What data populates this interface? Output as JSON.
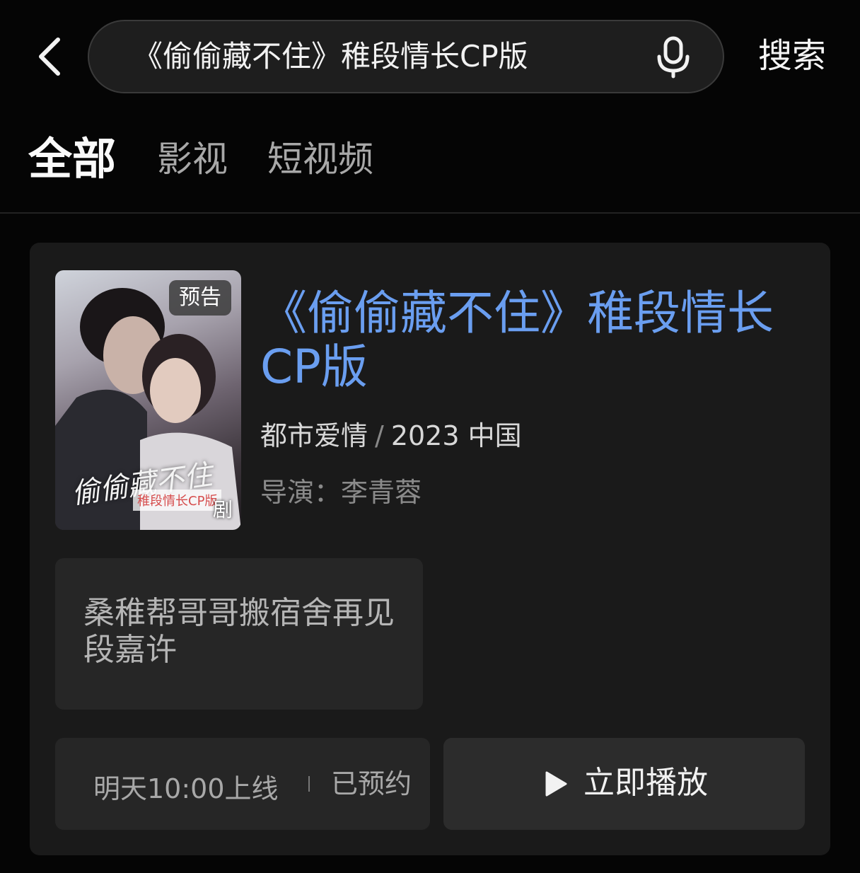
{
  "search": {
    "query": "《偷偷藏不住》稚段情长CP版",
    "button_label": "搜索"
  },
  "tabs": [
    {
      "label": "全部",
      "active": true
    },
    {
      "label": "影视",
      "active": false
    },
    {
      "label": "短视频",
      "active": false
    }
  ],
  "result": {
    "poster": {
      "badge": "预告",
      "corner_tag": "剧",
      "logo_text": "偷偷藏不住",
      "logo_subtitle": "稚段情长CP版"
    },
    "title": "《偷偷藏不住》稚段情长CP版",
    "genre": "都市爱情",
    "separator": "/",
    "year_region": "2023 中国",
    "director": "导演：李青蓉",
    "description": "桑稚帮哥哥搬宿舍再见段嘉许",
    "reserve": {
      "time": "明天10:00上线",
      "status": "已预约"
    },
    "play_label": "立即播放"
  },
  "colors": {
    "background": "#050505",
    "card": "#1a1a1a",
    "title_accent": "#6a9ef0"
  },
  "icons": [
    "back-arrow-icon",
    "microphone-icon",
    "play-icon"
  ]
}
